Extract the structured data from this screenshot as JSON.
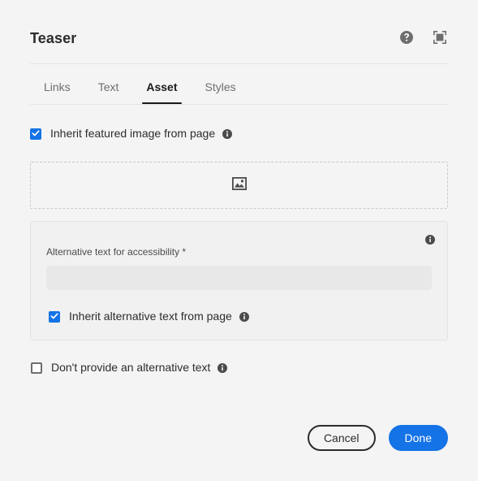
{
  "dialog": {
    "title": "Teaser",
    "header_actions": [
      {
        "name": "help-icon",
        "label": "Help"
      },
      {
        "name": "fullscreen-icon",
        "label": "Fullscreen"
      }
    ]
  },
  "tabs": [
    {
      "label": "Links",
      "selected": false
    },
    {
      "label": "Text",
      "selected": false
    },
    {
      "label": "Asset",
      "selected": true
    },
    {
      "label": "Styles",
      "selected": false
    }
  ],
  "asset": {
    "inherit_featured_image": {
      "label": "Inherit featured image from page",
      "checked": true
    },
    "dropzone": {
      "icon": "image-placeholder-icon"
    },
    "alt_text": {
      "label": "Alternative text for accessibility *",
      "value": "",
      "placeholder": "",
      "inherit": {
        "label": "Inherit alternative text from page",
        "checked": true
      }
    },
    "no_alt_text": {
      "label": "Don't provide an alternative text",
      "checked": false
    }
  },
  "footer": {
    "cancel_label": "Cancel",
    "done_label": "Done"
  },
  "colors": {
    "accent": "#1473e6",
    "page_background": "#f4f4f4",
    "text": "#2c2c2c",
    "muted_text": "#6e6e6e",
    "border": "#e4e4e4",
    "input_fill": "#e8e8e8"
  }
}
